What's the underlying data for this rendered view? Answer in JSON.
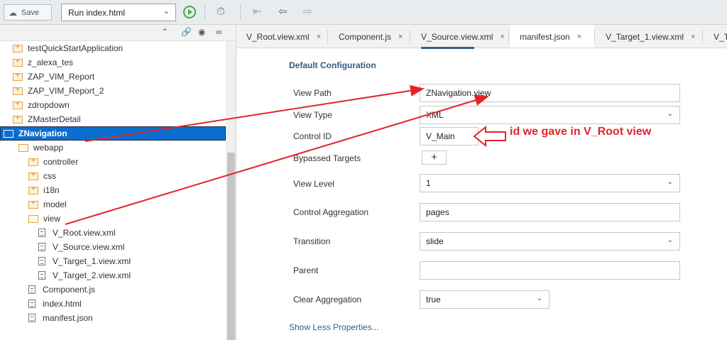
{
  "toolbar": {
    "save_label": "Save",
    "run_config": "Run index.html",
    "icons": [
      "cloud-save-icon",
      "run-icon",
      "timer-icon",
      "collapse-icon",
      "back-icon",
      "forward-icon"
    ]
  },
  "tree": {
    "items": [
      {
        "label": "testQuickStartApplication",
        "type": "folder"
      },
      {
        "label": "z_alexa_tes",
        "type": "folder"
      },
      {
        "label": "ZAP_VIM_Report",
        "type": "folder"
      },
      {
        "label": "ZAP_VIM_Report_2",
        "type": "folder"
      },
      {
        "label": "zdropdown",
        "type": "folder"
      },
      {
        "label": "ZMasterDetail",
        "type": "folder"
      },
      {
        "label": "ZNavigation",
        "type": "folder-open",
        "selected": true
      },
      {
        "label": "webapp",
        "type": "folder-open"
      },
      {
        "label": "controller",
        "type": "folder"
      },
      {
        "label": "css",
        "type": "folder"
      },
      {
        "label": "i18n",
        "type": "folder"
      },
      {
        "label": "model",
        "type": "folder"
      },
      {
        "label": "view",
        "type": "folder-open"
      },
      {
        "label": "V_Root.view.xml",
        "type": "file"
      },
      {
        "label": "V_Source.view.xml",
        "type": "file"
      },
      {
        "label": "V_Target_1.view.xml",
        "type": "file"
      },
      {
        "label": "V_Target_2.view.xml",
        "type": "file"
      },
      {
        "label": "Component.js",
        "type": "file"
      },
      {
        "label": "index.html",
        "type": "file"
      },
      {
        "label": "manifest.json",
        "type": "file"
      }
    ]
  },
  "tabs": [
    {
      "label": "V_Root.view.xml",
      "active": false
    },
    {
      "label": "Component.js",
      "active": false
    },
    {
      "label": "V_Source.view.xml",
      "active": false
    },
    {
      "label": "manifest.json",
      "active": true
    },
    {
      "label": "V_Target_1.view.xml",
      "active": false
    },
    {
      "label": "V_Ta",
      "active": false
    }
  ],
  "form": {
    "section_title": "Default Configuration",
    "view_path": {
      "label": "View Path",
      "value": "ZNavigation.view"
    },
    "view_type": {
      "label": "View Type",
      "value": "XML"
    },
    "control_id": {
      "label": "Control ID",
      "value": "V_Main"
    },
    "bypassed_targets": {
      "label": "Bypassed Targets",
      "button": "+"
    },
    "view_level": {
      "label": "View Level",
      "value": "1"
    },
    "control_aggregation": {
      "label": "Control Aggregation",
      "value": "pages"
    },
    "transition": {
      "label": "Transition",
      "value": "slide"
    },
    "parent": {
      "label": "Parent",
      "value": ""
    },
    "clear_aggregation": {
      "label": "Clear Aggregation",
      "value": "true"
    },
    "show_less": "Show Less Properties..."
  },
  "annotation": {
    "text": "id we gave in V_Root view",
    "color": "#e3242b"
  },
  "colors": {
    "selection": "#0a6ed1",
    "accent": "#346187"
  }
}
